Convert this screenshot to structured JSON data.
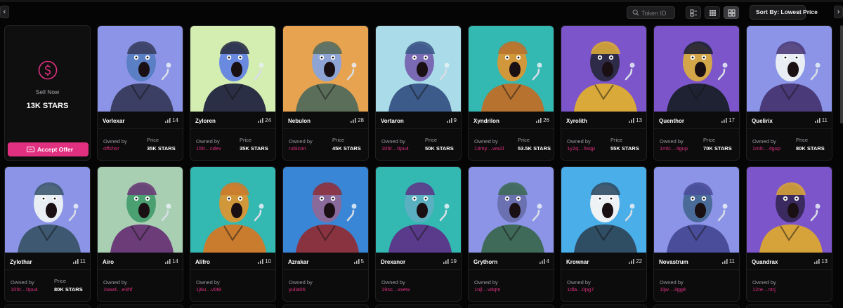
{
  "toolbar": {
    "search_placeholder": "Token ID",
    "sort_label": "Sort By: Lowest Price",
    "view_modes": [
      "list-view-icon",
      "small-grid-icon",
      "large-grid-icon"
    ],
    "active_view": "large-grid-icon"
  },
  "sell_card": {
    "label": "Sell Now",
    "value": "13K STARS",
    "button": "Accept Offer"
  },
  "labels": {
    "owned_by": "Owned by",
    "price": "Price"
  },
  "colors": {
    "accent": "#e0307f",
    "background": "#050505",
    "card": "#0c0c0d"
  },
  "nfts": [
    {
      "name": "Vorlexar",
      "rank": "14",
      "owner": "offshor",
      "price": "35K STARS",
      "bg": "#8b94e6"
    },
    {
      "name": "Zyloren",
      "rank": "24",
      "owner": "15tt…cdev",
      "price": "35K STARS",
      "bg": "#d3eeb0"
    },
    {
      "name": "Nebulon",
      "rank": "28",
      "owner": "rubicon",
      "price": "45K STARS",
      "bg": "#e7a34f"
    },
    {
      "name": "Vortaron",
      "rank": "9",
      "owner": "105t…0pu4",
      "price": "50K STARS",
      "bg": "#a9dce8"
    },
    {
      "name": "Xyndrilon",
      "rank": "26",
      "owner": "13my…ww2l",
      "price": "53.5K STARS",
      "bg": "#33b8b2"
    },
    {
      "name": "Xyrolith",
      "rank": "13",
      "owner": "1y2q…5sqp",
      "price": "55K STARS",
      "bg": "#7b55c9"
    },
    {
      "name": "Quenthor",
      "rank": "17",
      "owner": "1mlc…4gup",
      "price": "70K STARS",
      "bg": "#7b55c9"
    },
    {
      "name": "Quelirix",
      "rank": "11",
      "owner": "1mlc…4gup",
      "price": "80K STARS",
      "bg": "#8b94e6"
    },
    {
      "name": "Zylothar",
      "rank": "11",
      "owner": "105t…0pu4",
      "price": "80K STARS",
      "bg": "#8b94e6"
    },
    {
      "name": "Airo",
      "rank": "14",
      "owner": "1ww4…e3hf",
      "price": "",
      "bg": "#a8cfb2"
    },
    {
      "name": "Alifro",
      "rank": "10",
      "owner": "1j6u…v0t8",
      "price": "",
      "bg": "#33b8b2"
    },
    {
      "name": "Azrakar",
      "rank": "5",
      "owner": "yulia06",
      "price": "",
      "bg": "#3a86d6"
    },
    {
      "name": "Drexanor",
      "rank": "19",
      "owner": "19ss…xxew",
      "price": "",
      "bg": "#33b8b2"
    },
    {
      "name": "Grythorn",
      "rank": "4",
      "owner": "1njl…vdqm",
      "price": "",
      "bg": "#8b94e6"
    },
    {
      "name": "Krownar",
      "rank": "22",
      "owner": "1dla…0pg7",
      "price": "",
      "bg": "#4aaee8"
    },
    {
      "name": "Novastrum",
      "rank": "11",
      "owner": "1ljw…3gg8",
      "price": "",
      "bg": "#8b94e6"
    },
    {
      "name": "Quandrax",
      "rank": "13",
      "owner": "12re…ntrj",
      "price": "",
      "bg": "#7b55c9"
    }
  ]
}
